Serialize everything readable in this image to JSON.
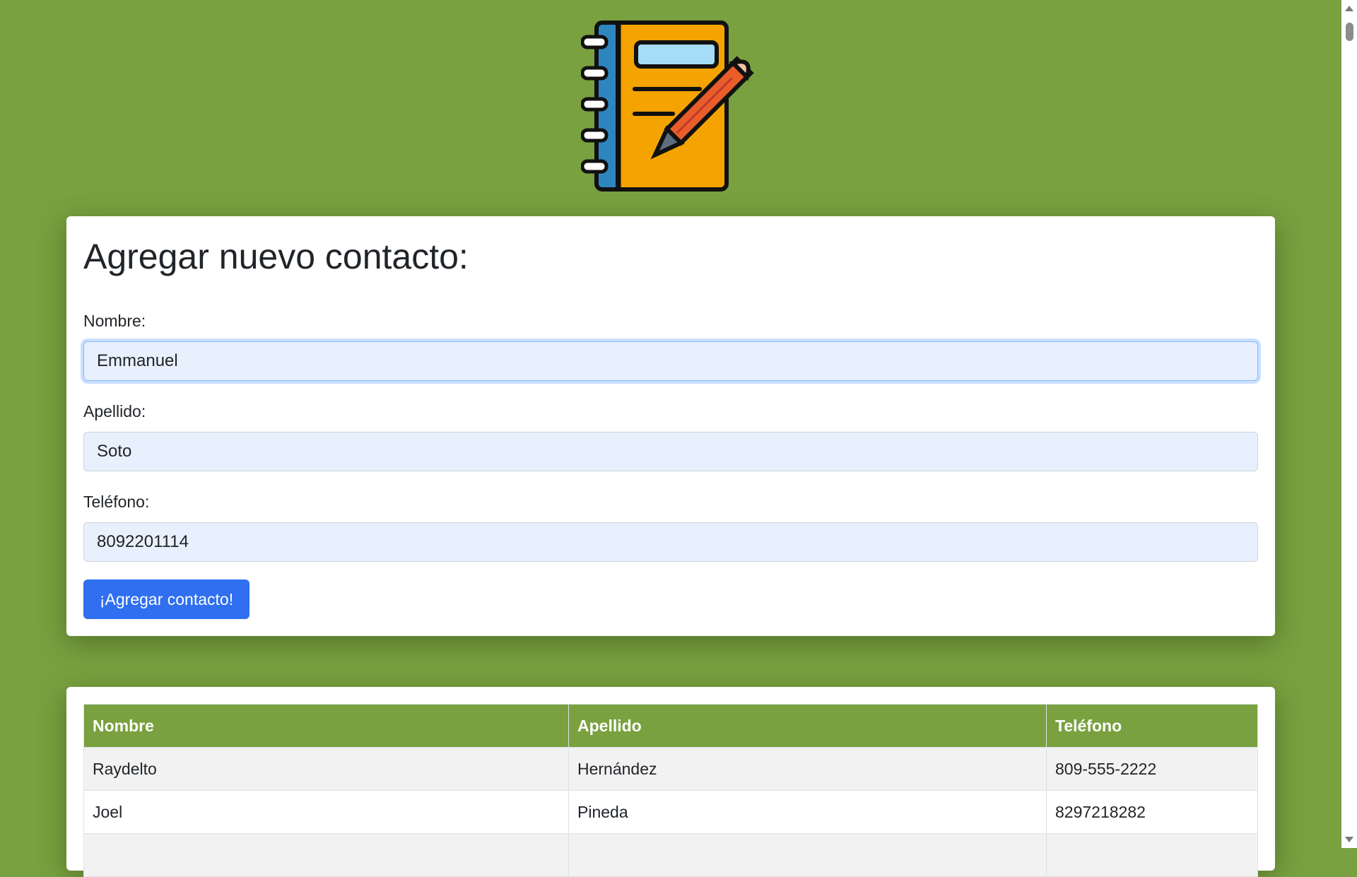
{
  "logo": {
    "icon": "notebook-pencil-icon"
  },
  "form": {
    "title": "Agregar nuevo contacto:",
    "fields": [
      {
        "label": "Nombre:",
        "value": "Emmanuel",
        "focused": true
      },
      {
        "label": "Apellido:",
        "value": "Soto",
        "focused": false
      },
      {
        "label": "Teléfono:",
        "value": "8092201114",
        "focused": false
      }
    ],
    "submit_label": "¡Agregar contacto!"
  },
  "table": {
    "headers": [
      "Nombre",
      "Apellido",
      "Teléfono"
    ],
    "rows": [
      [
        "Raydelto",
        "Hernández",
        "809-555-2222"
      ],
      [
        "Joel",
        "Pineda",
        "8297218282"
      ],
      [
        "",
        "",
        ""
      ]
    ]
  },
  "colors": {
    "background": "#79a13f",
    "header": "#79a13f",
    "button": "#2f6ff0",
    "input_fill": "#e8f0fe"
  }
}
